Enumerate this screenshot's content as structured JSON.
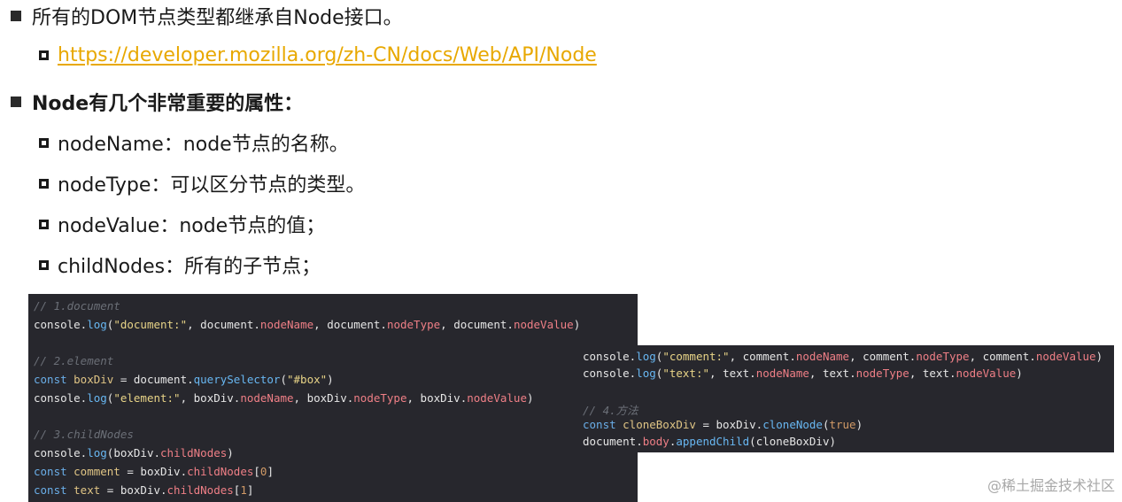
{
  "items": {
    "dom_inherit": "所有的DOM节点类型都继承自Node接口。",
    "mdn_link": "https://developer.mozilla.org/zh-CN/docs/Web/API/Node",
    "props_title": "Node有几个非常重要的属性：",
    "node_name": "nodeName：node节点的名称。",
    "node_type": "nodeType：可以区分节点的类型。",
    "node_value": "nodeValue：node节点的值；",
    "child_nodes": "childNodes：所有的子节点；"
  },
  "code_left": {
    "l1": "// 1.document",
    "l2_a": "console.",
    "l2_b": "log",
    "l2_c": "(",
    "l2_d": "\"document:\"",
    "l2_e": ", document.",
    "l2_f": "nodeName",
    "l2_g": ", document.",
    "l2_h": "nodeType",
    "l2_i": ", document.",
    "l2_j": "nodeValue",
    "l2_k": ")",
    "l3": "// 2.element",
    "l4_a": "const ",
    "l4_b": "boxDiv",
    "l4_c": " = document.",
    "l4_d": "querySelector",
    "l4_e": "(",
    "l4_f": "\"#box\"",
    "l4_g": ")",
    "l5_a": "console.",
    "l5_b": "log",
    "l5_c": "(",
    "l5_d": "\"element:\"",
    "l5_e": ", boxDiv.",
    "l5_f": "nodeName",
    "l5_g": ", boxDiv.",
    "l5_h": "nodeType",
    "l5_i": ", boxDiv.",
    "l5_j": "nodeValue",
    "l5_k": ")",
    "l6": "// 3.childNodes",
    "l7_a": "console.",
    "l7_b": "log",
    "l7_c": "(boxDiv.",
    "l7_d": "childNodes",
    "l7_e": ")",
    "l8_a": "const ",
    "l8_b": "comment",
    "l8_c": " = boxDiv.",
    "l8_d": "childNodes",
    "l8_e": "[",
    "l8_f": "0",
    "l8_g": "]",
    "l9_a": "const ",
    "l9_b": "text",
    "l9_c": " = boxDiv.",
    "l9_d": "childNodes",
    "l9_e": "[",
    "l9_f": "1",
    "l9_g": "]"
  },
  "code_right": {
    "r1_a": "console.",
    "r1_b": "log",
    "r1_c": "(",
    "r1_d": "\"comment:\"",
    "r1_e": ", comment.",
    "r1_f": "nodeName",
    "r1_g": ", comment.",
    "r1_h": "nodeType",
    "r1_i": ", comment.",
    "r1_j": "nodeValue",
    "r1_k": ")",
    "r2_a": "console.",
    "r2_b": "log",
    "r2_c": "(",
    "r2_d": "\"text:\"",
    "r2_e": ", text.",
    "r2_f": "nodeName",
    "r2_g": ", text.",
    "r2_h": "nodeType",
    "r2_i": ", text.",
    "r2_j": "nodeValue",
    "r2_k": ")",
    "r3": "// 4.方法",
    "r4_a": "const ",
    "r4_b": "cloneBoxDiv",
    "r4_c": " = boxDiv.",
    "r4_d": "cloneNode",
    "r4_e": "(",
    "r4_f": "true",
    "r4_g": ")",
    "r5_a": "document.",
    "r5_b": "body",
    "r5_c": ".",
    "r5_d": "appendChild",
    "r5_e": "(cloneBoxDiv)"
  },
  "watermark": "@稀土掘金技术社区",
  "colors": {
    "link": "#e8a800",
    "code_bg": "#27272d",
    "string": "#e8d487",
    "function": "#68b7f2",
    "property": "#ef7f86",
    "comment": "#6b6f77"
  }
}
